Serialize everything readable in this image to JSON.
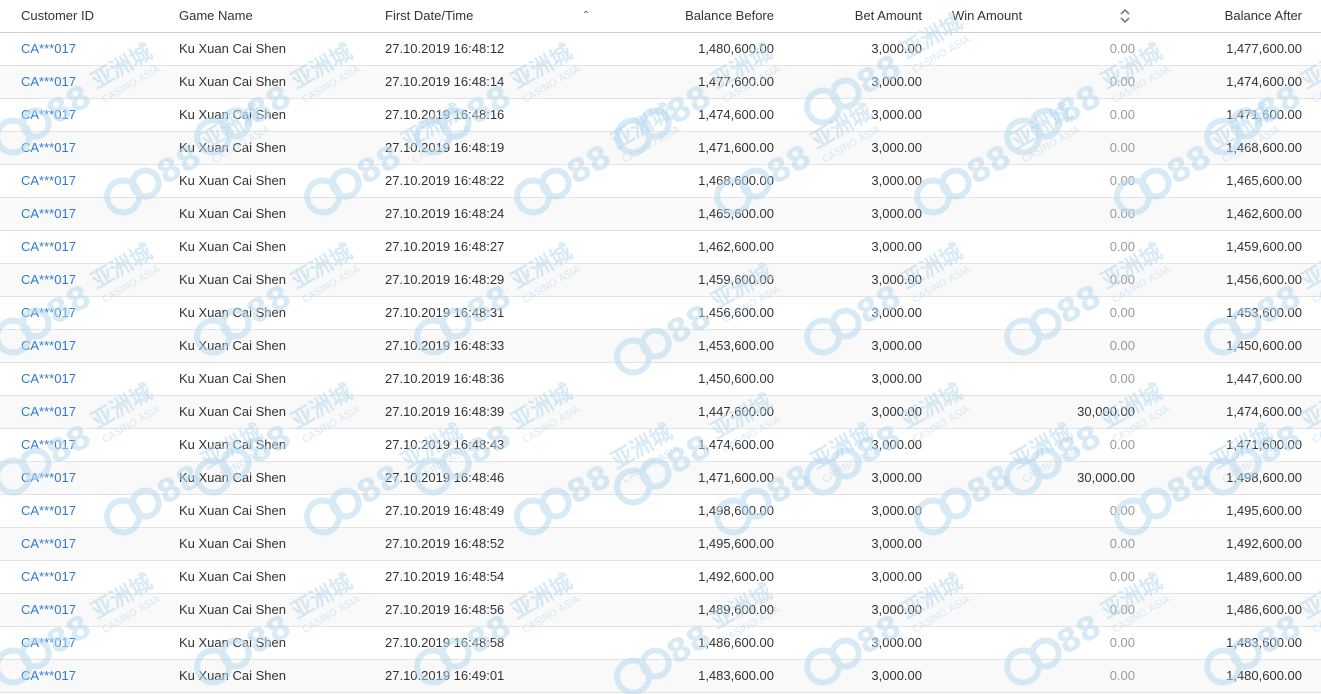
{
  "colors": {
    "link": "#2f7ad0",
    "muted": "#9a9a9a",
    "watermark": "#b8d9ef"
  },
  "header": {
    "customer_id": "Customer ID",
    "game_name": "Game Name",
    "first_date_time": "First Date/Time",
    "balance_before": "Balance Before",
    "bet_amount": "Bet Amount",
    "win_amount": "Win Amount",
    "balance_after": "Balance After",
    "sort_asc_icon": "chevron-up-icon",
    "sort_both_icon": "sort-updown-icon"
  },
  "watermark": {
    "brand": "CCI88",
    "chinese": "亚洲城",
    "sub": "CASINO ASIA"
  },
  "rows": [
    {
      "customer": "CA***017",
      "game": "Ku Xuan Cai Shen",
      "date": "27.10.2019 16:48:12",
      "balance_before": "1,480,600.00",
      "bet": "3,000.00",
      "win": "0.00",
      "balance_after": "1,477,600.00"
    },
    {
      "customer": "CA***017",
      "game": "Ku Xuan Cai Shen",
      "date": "27.10.2019 16:48:14",
      "balance_before": "1,477,600.00",
      "bet": "3,000.00",
      "win": "0.00",
      "balance_after": "1,474,600.00"
    },
    {
      "customer": "CA***017",
      "game": "Ku Xuan Cai Shen",
      "date": "27.10.2019 16:48:16",
      "balance_before": "1,474,600.00",
      "bet": "3,000.00",
      "win": "0.00",
      "balance_after": "1,471,600.00"
    },
    {
      "customer": "CA***017",
      "game": "Ku Xuan Cai Shen",
      "date": "27.10.2019 16:48:19",
      "balance_before": "1,471,600.00",
      "bet": "3,000.00",
      "win": "0.00",
      "balance_after": "1,468,600.00"
    },
    {
      "customer": "CA***017",
      "game": "Ku Xuan Cai Shen",
      "date": "27.10.2019 16:48:22",
      "balance_before": "1,468,600.00",
      "bet": "3,000.00",
      "win": "0.00",
      "balance_after": "1,465,600.00"
    },
    {
      "customer": "CA***017",
      "game": "Ku Xuan Cai Shen",
      "date": "27.10.2019 16:48:24",
      "balance_before": "1,465,600.00",
      "bet": "3,000.00",
      "win": "0.00",
      "balance_after": "1,462,600.00"
    },
    {
      "customer": "CA***017",
      "game": "Ku Xuan Cai Shen",
      "date": "27.10.2019 16:48:27",
      "balance_before": "1,462,600.00",
      "bet": "3,000.00",
      "win": "0.00",
      "balance_after": "1,459,600.00"
    },
    {
      "customer": "CA***017",
      "game": "Ku Xuan Cai Shen",
      "date": "27.10.2019 16:48:29",
      "balance_before": "1,459,600.00",
      "bet": "3,000.00",
      "win": "0.00",
      "balance_after": "1,456,600.00"
    },
    {
      "customer": "CA***017",
      "game": "Ku Xuan Cai Shen",
      "date": "27.10.2019 16:48:31",
      "balance_before": "1,456,600.00",
      "bet": "3,000.00",
      "win": "0.00",
      "balance_after": "1,453,600.00"
    },
    {
      "customer": "CA***017",
      "game": "Ku Xuan Cai Shen",
      "date": "27.10.2019 16:48:33",
      "balance_before": "1,453,600.00",
      "bet": "3,000.00",
      "win": "0.00",
      "balance_after": "1,450,600.00"
    },
    {
      "customer": "CA***017",
      "game": "Ku Xuan Cai Shen",
      "date": "27.10.2019 16:48:36",
      "balance_before": "1,450,600.00",
      "bet": "3,000.00",
      "win": "0.00",
      "balance_after": "1,447,600.00"
    },
    {
      "customer": "CA***017",
      "game": "Ku Xuan Cai Shen",
      "date": "27.10.2019 16:48:39",
      "balance_before": "1,447,600.00",
      "bet": "3,000.00",
      "win": "30,000.00",
      "balance_after": "1,474,600.00"
    },
    {
      "customer": "CA***017",
      "game": "Ku Xuan Cai Shen",
      "date": "27.10.2019 16:48:43",
      "balance_before": "1,474,600.00",
      "bet": "3,000.00",
      "win": "0.00",
      "balance_after": "1,471,600.00"
    },
    {
      "customer": "CA***017",
      "game": "Ku Xuan Cai Shen",
      "date": "27.10.2019 16:48:46",
      "balance_before": "1,471,600.00",
      "bet": "3,000.00",
      "win": "30,000.00",
      "balance_after": "1,498,600.00"
    },
    {
      "customer": "CA***017",
      "game": "Ku Xuan Cai Shen",
      "date": "27.10.2019 16:48:49",
      "balance_before": "1,498,600.00",
      "bet": "3,000.00",
      "win": "0.00",
      "balance_after": "1,495,600.00"
    },
    {
      "customer": "CA***017",
      "game": "Ku Xuan Cai Shen",
      "date": "27.10.2019 16:48:52",
      "balance_before": "1,495,600.00",
      "bet": "3,000.00",
      "win": "0.00",
      "balance_after": "1,492,600.00"
    },
    {
      "customer": "CA***017",
      "game": "Ku Xuan Cai Shen",
      "date": "27.10.2019 16:48:54",
      "balance_before": "1,492,600.00",
      "bet": "3,000.00",
      "win": "0.00",
      "balance_after": "1,489,600.00"
    },
    {
      "customer": "CA***017",
      "game": "Ku Xuan Cai Shen",
      "date": "27.10.2019 16:48:56",
      "balance_before": "1,489,600.00",
      "bet": "3,000.00",
      "win": "0.00",
      "balance_after": "1,486,600.00"
    },
    {
      "customer": "CA***017",
      "game": "Ku Xuan Cai Shen",
      "date": "27.10.2019 16:48:58",
      "balance_before": "1,486,600.00",
      "bet": "3,000.00",
      "win": "0.00",
      "balance_after": "1,483,600.00"
    },
    {
      "customer": "CA***017",
      "game": "Ku Xuan Cai Shen",
      "date": "27.10.2019 16:49:01",
      "balance_before": "1,483,600.00",
      "bet": "3,000.00",
      "win": "0.00",
      "balance_after": "1,480,600.00"
    }
  ]
}
